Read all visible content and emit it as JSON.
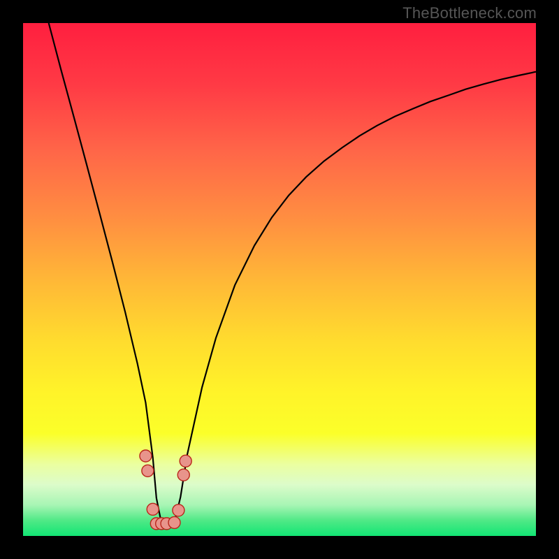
{
  "watermark": "TheBottleneck.com",
  "chart_data": {
    "type": "line",
    "title": "",
    "xlabel": "",
    "ylabel": "",
    "xlim": [
      0,
      100
    ],
    "ylim": [
      0,
      100
    ],
    "curve": {
      "x": [
        5.0,
        7.4,
        9.9,
        12.4,
        14.9,
        17.4,
        19.9,
        22.3,
        23.9,
        25.3,
        26.0,
        27.0,
        28.0,
        29.5,
        30.7,
        32.0,
        34.9,
        37.6,
        41.3,
        45.1,
        48.5,
        51.8,
        55.2,
        58.7,
        62.2,
        65.6,
        69.0,
        72.5,
        76.0,
        79.4,
        82.9,
        86.3,
        89.8,
        93.2,
        96.7,
        100.0
      ],
      "y": [
        100.0,
        90.9,
        81.7,
        72.4,
        63.0,
        53.5,
        43.7,
        33.6,
        26.0,
        15.3,
        7.4,
        2.4,
        2.4,
        2.6,
        7.6,
        15.8,
        29.0,
        38.6,
        48.9,
        56.6,
        62.1,
        66.4,
        70.0,
        73.1,
        75.7,
        78.0,
        80.0,
        81.8,
        83.3,
        84.7,
        85.9,
        87.1,
        88.1,
        89.0,
        89.8,
        90.5
      ]
    },
    "highlight_points": [
      {
        "x": 23.9,
        "y": 15.6
      },
      {
        "x": 24.3,
        "y": 12.7
      },
      {
        "x": 25.3,
        "y": 5.2
      },
      {
        "x": 26.0,
        "y": 2.4
      },
      {
        "x": 27.0,
        "y": 2.4
      },
      {
        "x": 28.0,
        "y": 2.4
      },
      {
        "x": 29.5,
        "y": 2.6
      },
      {
        "x": 30.3,
        "y": 5.0
      },
      {
        "x": 31.3,
        "y": 11.9
      },
      {
        "x": 31.7,
        "y": 14.6
      }
    ],
    "background_gradient": {
      "stops": [
        {
          "offset": 0.0,
          "color": "#ff1f3f"
        },
        {
          "offset": 0.12,
          "color": "#ff3a45"
        },
        {
          "offset": 0.25,
          "color": "#ff6648"
        },
        {
          "offset": 0.38,
          "color": "#ff8e41"
        },
        {
          "offset": 0.5,
          "color": "#ffb737"
        },
        {
          "offset": 0.62,
          "color": "#ffdc2e"
        },
        {
          "offset": 0.72,
          "color": "#fff329"
        },
        {
          "offset": 0.8,
          "color": "#fbff29"
        },
        {
          "offset": 0.86,
          "color": "#ebffa0"
        },
        {
          "offset": 0.9,
          "color": "#dcfcca"
        },
        {
          "offset": 0.94,
          "color": "#a7f5b4"
        },
        {
          "offset": 0.97,
          "color": "#4fe986"
        },
        {
          "offset": 1.0,
          "color": "#12e574"
        }
      ]
    },
    "marker_color": "#e8948b",
    "marker_stroke": "#b9261b",
    "curve_stroke": "#000000"
  }
}
